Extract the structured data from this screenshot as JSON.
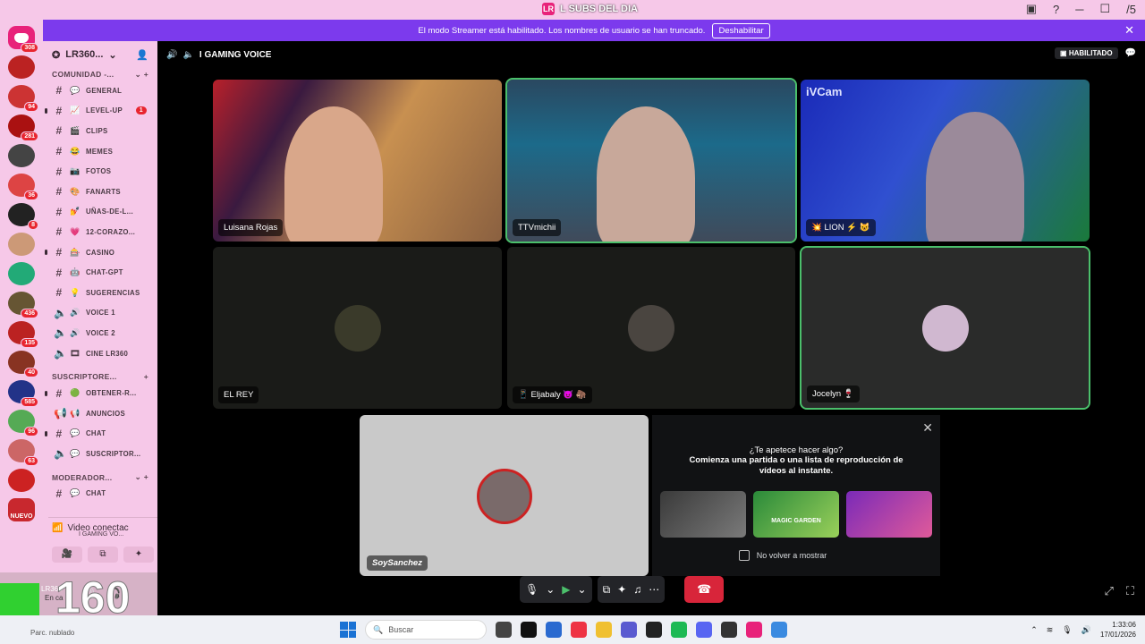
{
  "titlebar": {
    "title": "L SUBS DEL DIA",
    "app_icon": "LR"
  },
  "banner": {
    "text": "El modo Streamer está habilitado. Los nombres de usuario se han truncado.",
    "button": "Deshabilitar"
  },
  "guilds": {
    "home_badge": "308",
    "new_label": "NUEVO",
    "badges": [
      "",
      "94",
      "281",
      "",
      "36",
      "8",
      "",
      "",
      "436",
      "135",
      "40",
      "585",
      "96",
      "63",
      "",
      "",
      ""
    ]
  },
  "server": {
    "name": "LR360..."
  },
  "categories": {
    "comunidad": "COMUNIDAD -...",
    "suscriptores": "SUSCRIPTORE...",
    "moderadores": "MODERADOR..."
  },
  "channels": {
    "general": {
      "label": "GENERAL",
      "emoji": "💬"
    },
    "levelup": {
      "label": "LEVEL-UP",
      "emoji": "📈",
      "badge": "1"
    },
    "clips": {
      "label": "CLIPS",
      "emoji": "🎬"
    },
    "memes": {
      "label": "MEMES",
      "emoji": "😂"
    },
    "fotos": {
      "label": "FOTOS",
      "emoji": "📷"
    },
    "fanarts": {
      "label": "FANARTS",
      "emoji": "🎨"
    },
    "unas": {
      "label": "UÑAS-DE-L...",
      "emoji": "💅"
    },
    "corazo": {
      "label": "12-CORAZO...",
      "emoji": "💗"
    },
    "casino": {
      "label": "CASINO",
      "emoji": "🎰"
    },
    "chatgpt": {
      "label": "CHAT-GPT",
      "emoji": "🤖"
    },
    "sugerencias": {
      "label": "SUGERENCIAS",
      "emoji": "💡"
    },
    "voice1": {
      "label": "VOICE 1",
      "emoji": "🔊"
    },
    "voice2": {
      "label": "VOICE 2",
      "emoji": "🔊"
    },
    "cine": {
      "label": "CINE LR360",
      "emoji": "🎞"
    },
    "obtener": {
      "label": "OBTENER-R...",
      "emoji": "🟢"
    },
    "anuncios": {
      "label": "ANUNCIOS",
      "emoji": "📢"
    },
    "chat_sub": {
      "label": "CHAT",
      "emoji": "💬"
    },
    "suscriptor": {
      "label": "SUSCRIPTOR...",
      "emoji": "💬"
    },
    "chat_mod": {
      "label": "CHAT",
      "emoji": "💬"
    }
  },
  "voice_panel": {
    "status": "Video conectac",
    "channel": "I GAMING VO..."
  },
  "overlay": {
    "big_number": "160"
  },
  "user": {
    "name": "LR360",
    "status": "En ca"
  },
  "channel_header": {
    "title": "I GAMING VOICE",
    "enabled_label": "HABILITADO"
  },
  "participants": [
    {
      "name": "Luisana Rojas"
    },
    {
      "name": "TTVmichii"
    },
    {
      "name": "💥 LION ⚡ 😺",
      "cam_label": "iVCam"
    },
    {
      "name": "EL REY"
    },
    {
      "name": "📱 Eljabaly 😈 🦣"
    },
    {
      "name": "Jocelyn 🍷"
    }
  ],
  "self": {
    "name": "SoySanchez"
  },
  "activity": {
    "question": "¿Te apetece hacer algo?",
    "subtitle": "Comienza una partida o una lista de reproducción de vídeos al instante.",
    "game2": "MAGIC GARDEN",
    "checkbox": "No volver a mostrar"
  },
  "taskbar": {
    "search": "Buscar",
    "weather": "Parc. nublado",
    "time": "1:33:06",
    "date": "17/01/2026"
  }
}
